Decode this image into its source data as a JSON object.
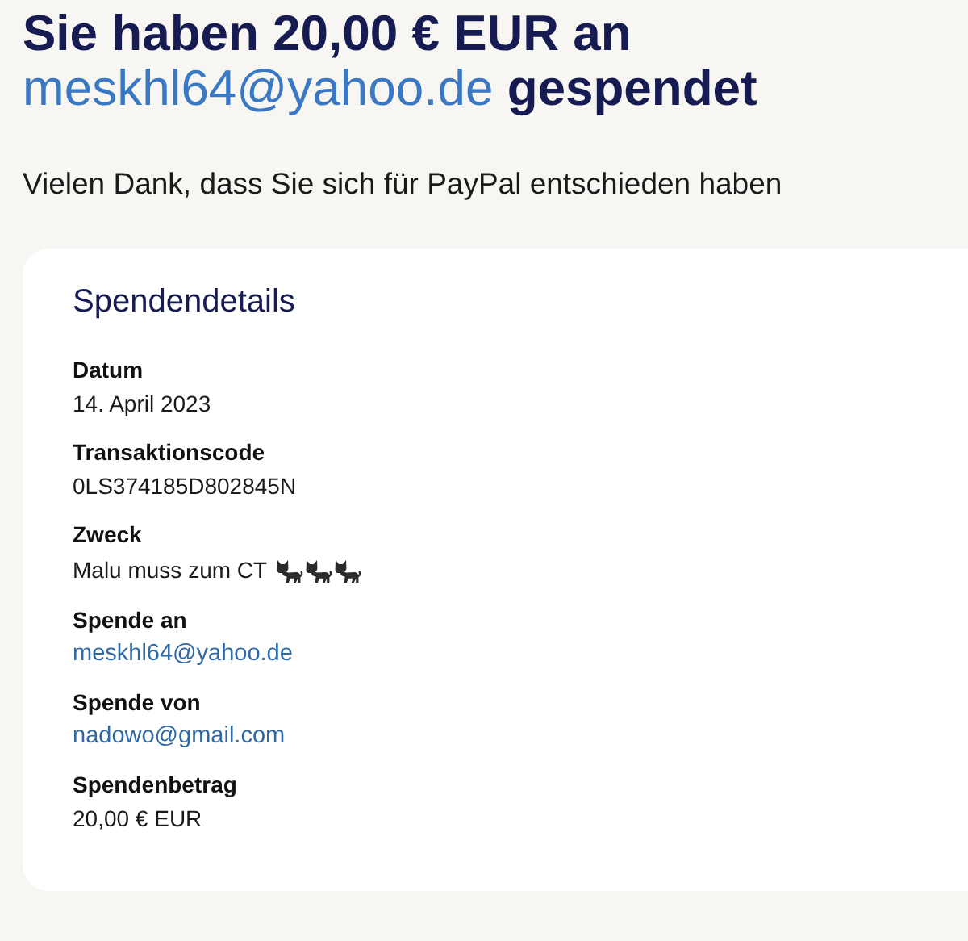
{
  "heading": {
    "before": "Sie haben 20,00 € EUR an",
    "link": "meskhl64@yahoo.de",
    "after": "gespendet"
  },
  "subtitle": "Vielen Dank, dass Sie sich für PayPal entschieden haben",
  "card": {
    "title": "Spendendetails",
    "details": [
      {
        "label": "Datum",
        "value": "14. April 2023",
        "kind": "text"
      },
      {
        "label": "Transaktionscode",
        "value": "0LS374185D802845N",
        "kind": "text"
      },
      {
        "label": "Zweck",
        "value": "Malu muss zum CT",
        "kind": "cats"
      },
      {
        "label": "Spende an",
        "value": "meskhl64@yahoo.de",
        "kind": "link"
      },
      {
        "label": "Spende von",
        "value": "nadowo@gmail.com",
        "kind": "link"
      },
      {
        "label": "Spendenbetrag",
        "value": "20,00 € EUR",
        "kind": "text"
      }
    ]
  }
}
